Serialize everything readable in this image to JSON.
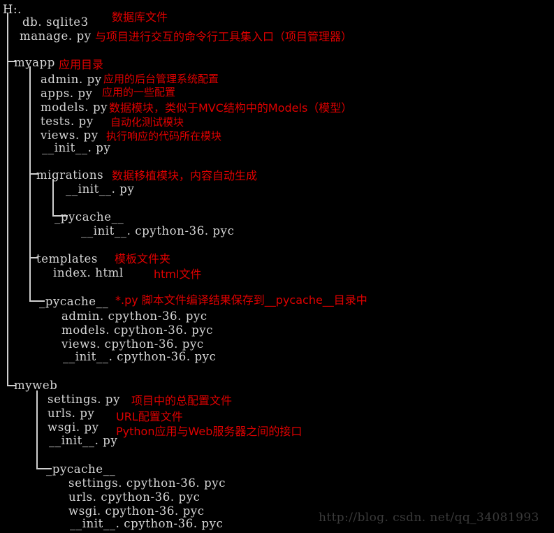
{
  "console": {
    "root": "H:.",
    "background_color": "#000000",
    "text_color": "#d6d6d6",
    "annotation_color": "#e00000",
    "watermark_color": "#3a3a3a"
  },
  "tree_lines": [
    {
      "text": "db. sqlite3"
    },
    {
      "text": "manage. py"
    },
    {
      "text": "myapp"
    },
    {
      "text": "admin. py"
    },
    {
      "text": "apps. py"
    },
    {
      "text": "models. py"
    },
    {
      "text": "tests. py"
    },
    {
      "text": "views. py"
    },
    {
      "text": "__init__. py"
    },
    {
      "text": "migrations"
    },
    {
      "text": "__init__. py"
    },
    {
      "text": "_pycache__"
    },
    {
      "text": "__init__. cpython-36. pyc"
    },
    {
      "text": "templates"
    },
    {
      "text": "index. html"
    },
    {
      "text": "_pycache__"
    },
    {
      "text": "admin. cpython-36. pyc"
    },
    {
      "text": "models. cpython-36. pyc"
    },
    {
      "text": "views. cpython-36. pyc"
    },
    {
      "text": "__init__. cpython-36. pyc"
    },
    {
      "text": "myweb"
    },
    {
      "text": "settings. py"
    },
    {
      "text": "urls. py"
    },
    {
      "text": "wsgi. py"
    },
    {
      "text": "__init__. py"
    },
    {
      "text": "_pycache__"
    },
    {
      "text": "settings. cpython-36. pyc"
    },
    {
      "text": "urls. cpython-36. pyc"
    },
    {
      "text": "wsgi. cpython-36. pyc"
    },
    {
      "text": "__init__. cpython-36. pyc"
    }
  ],
  "annotations": [
    {
      "text": "数据库文件"
    },
    {
      "text": "与项目进行交互的命令行工具集入口（项目管理器）"
    },
    {
      "text": "应用目录"
    },
    {
      "text": "应用的后台管理系统配置"
    },
    {
      "text": "应用的一些配置"
    },
    {
      "text": "数据模块，类似于MVC结构中的Models（模型）"
    },
    {
      "text": "自动化测试模块"
    },
    {
      "text": "执行响应的代码所在模块"
    },
    {
      "text": "数据移植模块，内容自动生成"
    },
    {
      "text": "模板文件夹"
    },
    {
      "text": "html文件"
    },
    {
      "text": "*.py 脚本文件编译结果保存到__pycache__目录中"
    },
    {
      "text": "项目中的总配置文件"
    },
    {
      "text": "URL配置文件"
    },
    {
      "text": "Python应用与Web服务器之间的接口"
    }
  ],
  "watermark": {
    "text": "http://blog. csdn. net/qq_34081993"
  }
}
